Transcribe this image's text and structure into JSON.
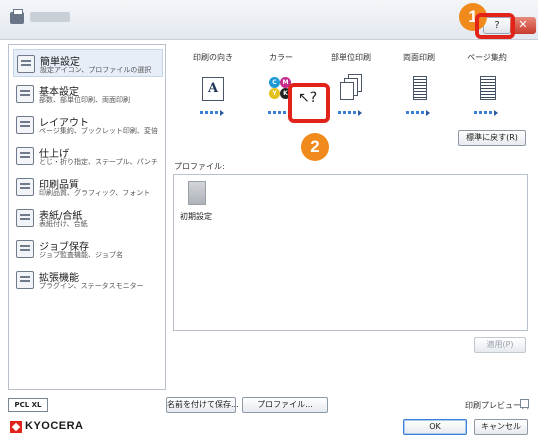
{
  "titlebar": {
    "help_label": "?",
    "close_label": "✕"
  },
  "callouts": {
    "first": "1",
    "second": "2"
  },
  "sidebar": {
    "items": [
      {
        "title": "簡単設定",
        "sub": "設定アイコン、プロファイルの選択"
      },
      {
        "title": "基本設定",
        "sub": "部数、部単位印刷、両面印刷"
      },
      {
        "title": "レイアウト",
        "sub": "ページ集約、ブックレット印刷、変倍"
      },
      {
        "title": "仕上げ",
        "sub": "とじ・折り指定、ステープル、パンチ"
      },
      {
        "title": "印刷品質",
        "sub": "印刷品質、グラフィック、フォント"
      },
      {
        "title": "表紙/合紙",
        "sub": "表紙付け、合紙"
      },
      {
        "title": "ジョブ保存",
        "sub": "ジョブ監査機能、ジョブ名"
      },
      {
        "title": "拡張機能",
        "sub": "プラグイン、ステータスモニター"
      }
    ]
  },
  "options": {
    "orientation_label": "印刷の向き",
    "color_label": "カラー",
    "collate_label": "部単位印刷",
    "duplex_label": "両面印刷",
    "nup_label": "ページ集約",
    "orientation_glyph": "A",
    "color_balls": [
      "C",
      "M",
      "Y",
      "K"
    ]
  },
  "buttons": {
    "reset": "標準に戻す(R)",
    "apply": "適用(P)",
    "save_as": "名前を付けて保存...",
    "profile": "プロファイル...",
    "ok": "OK",
    "cancel": "キャンセル"
  },
  "profile": {
    "label": "プロファイル:",
    "items": [
      {
        "name": "初期設定"
      }
    ]
  },
  "footer": {
    "pdl": "PCL XL",
    "logo": "KYOCERA",
    "preview_label": "印刷プレビュー(I)"
  },
  "colors": {
    "callout_red": "#e2231a",
    "callout_orange": "#f08a1c",
    "accent_blue": "#3c7fd6"
  }
}
